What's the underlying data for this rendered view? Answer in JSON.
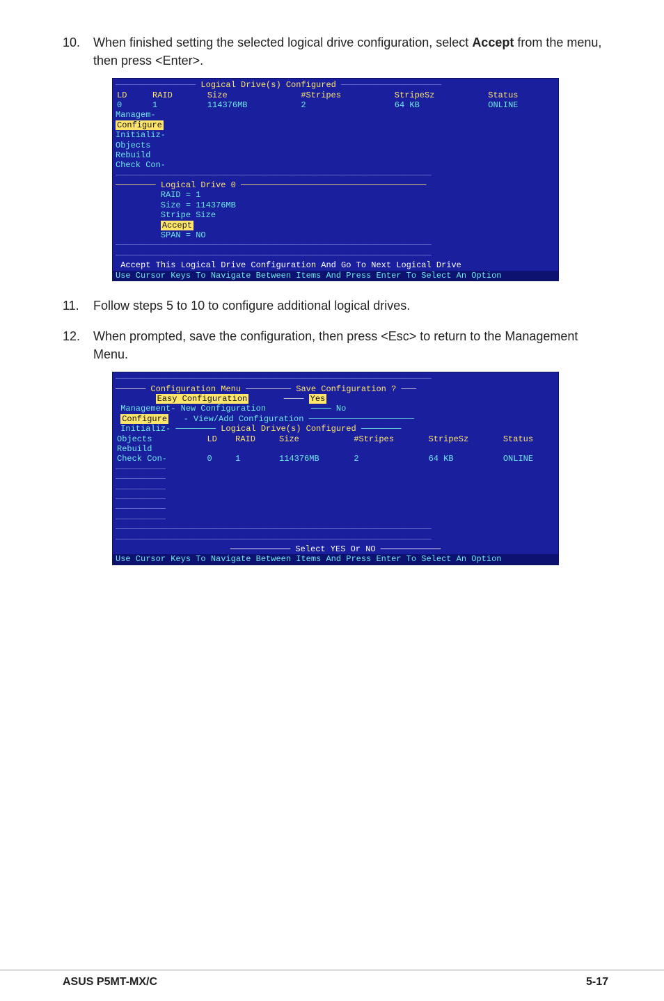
{
  "steps": {
    "s10": {
      "num": "10.",
      "text_pre": "When finished setting the selected logical drive configuration, select ",
      "bold": "Accept",
      "text_post": " from the menu, then press <Enter>."
    },
    "s11": {
      "num": "11.",
      "text": "Follow steps 5 to 10 to configure additional logical drives."
    },
    "s12": {
      "num": "12.",
      "text": "When prompted, save the configuration, then press <Esc> to return to the Management Menu."
    }
  },
  "term1": {
    "title": "Logical Drive(s) Configured",
    "headers": {
      "ld": "LD",
      "raid": "RAID",
      "size": "Size",
      "stripes": "#Stripes",
      "stripesz": "StripeSz",
      "status": "Status"
    },
    "row": {
      "ld": "0",
      "raid": "1",
      "size": "114376MB",
      "stripes": "2",
      "stripesz": "64  KB",
      "status": "ONLINE"
    },
    "menu": {
      "manage": "Managem-",
      "configure": "Configure",
      "initialize": "Initializ-",
      "objects": "Objects",
      "rebuild": "Rebuild",
      "checkcon": "Check Con-"
    },
    "subtitle": "Logical Drive 0",
    "sub": {
      "raid": "RAID = 1",
      "size": "Size = 114376MB",
      "stripe": "Stripe Size",
      "accept": "Accept",
      "span": "SPAN = NO"
    },
    "prompt": "Accept This Logical Drive Configuration And Go To Next Logical Drive",
    "hint": "Use Cursor Keys To Navigate Between Items And Press Enter To Select An Option"
  },
  "term2": {
    "cfg_title": "Configuration Menu",
    "save_title": "Save Configuration ?",
    "cfg_menu": {
      "easy": "Easy Configuration",
      "new": "New Configuration",
      "view": "View/Add Configuration"
    },
    "yes": "Yes",
    "no": "No",
    "title": "Logical Drive(s) Configured",
    "headers": {
      "ld": "LD",
      "raid": "RAID",
      "size": "Size",
      "stripes": "#Stripes",
      "stripesz": "StripeSz",
      "status": "Status"
    },
    "row": {
      "ld": "0",
      "raid": "1",
      "size": "114376MB",
      "stripes": "2",
      "stripesz": "64  KB",
      "status": "ONLINE"
    },
    "left_menu": {
      "management": "Management-",
      "configure": "Configure",
      "initialize": "Initializ-",
      "objects": "Objects",
      "rebuild": "Rebuild",
      "checkcon": "Check Con-"
    },
    "prompt": "Select YES Or NO",
    "hint": "Use Cursor Keys To Navigate Between Items And Press Enter To Select An Option"
  },
  "footer": {
    "left": "ASUS P5MT-MX/C",
    "right": "5-17"
  }
}
